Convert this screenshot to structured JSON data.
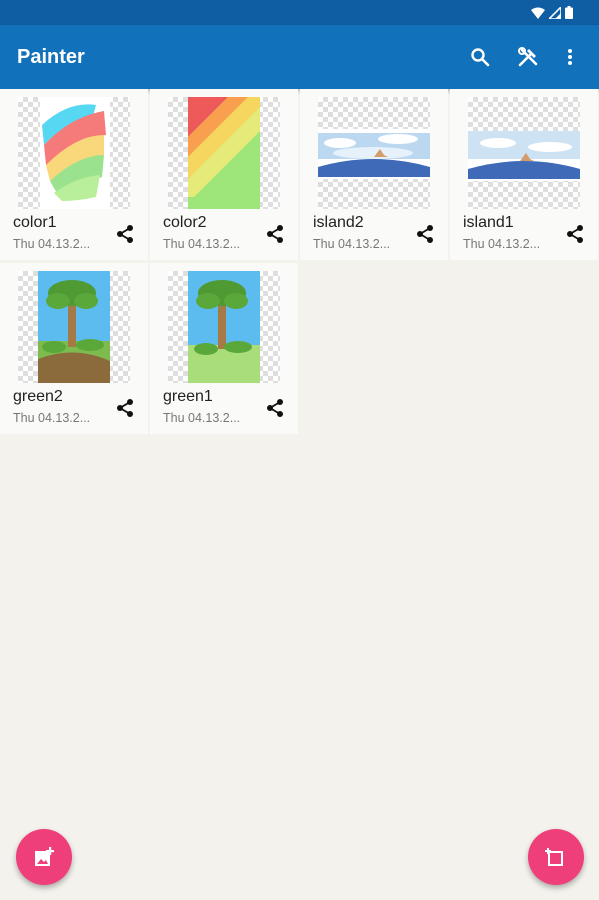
{
  "app": {
    "title": "Painter",
    "accent": "#1171ba",
    "statusbar_color": "#0f5da3",
    "fab_color": "#ef3f7a"
  },
  "toolbar": {
    "icons": [
      "search-icon",
      "tools-icon",
      "more-vert-icon"
    ]
  },
  "drawings": [
    {
      "title": "color1",
      "date": "Thu 04.13.2..."
    },
    {
      "title": "color2",
      "date": "Thu 04.13.2..."
    },
    {
      "title": "island2",
      "date": "Thu 04.13.2..."
    },
    {
      "title": "island1",
      "date": "Thu 04.13.2..."
    },
    {
      "title": "green2",
      "date": "Thu 04.13.2..."
    },
    {
      "title": "green1",
      "date": "Thu 04.13.2..."
    }
  ],
  "fabs": {
    "left_icon": "add-image-icon",
    "right_icon": "new-canvas-icon"
  }
}
